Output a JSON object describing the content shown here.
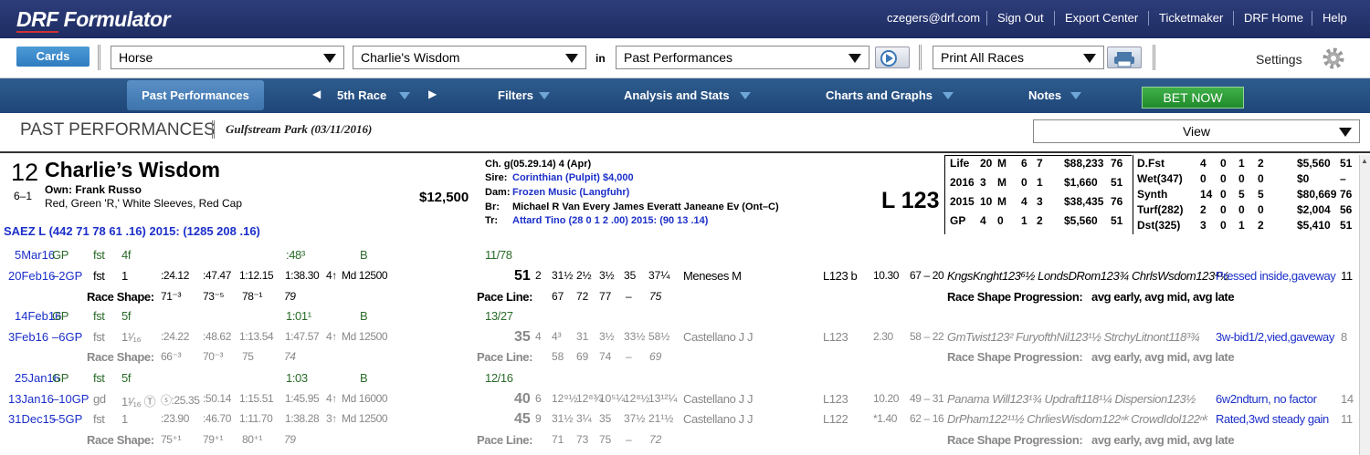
{
  "app": {
    "logo_a": "DRF",
    "logo_b": "Formulator"
  },
  "toplinks": [
    "czegers@drf.com",
    "Sign Out",
    "Export Center",
    "Ticketmaker",
    "DRF Home",
    "Help"
  ],
  "toolbar": {
    "cards": "Cards",
    "s1": "Horse",
    "s2": "Charlie's Wisdom",
    "in": "in",
    "s3": "Past Performances",
    "s4": "Print All Races",
    "settings": "Settings"
  },
  "nav": {
    "pp": "Past Performances",
    "race": "5th Race",
    "filters": "Filters",
    "analysis": "Analysis and Stats",
    "charts": "Charts and Graphs",
    "notes": "Notes",
    "bet": "BET NOW"
  },
  "section": {
    "title": "PAST PERFORMANCES",
    "track": "Gulfstream Park (03/11/2016)",
    "view": "View"
  },
  "horse": {
    "num": "12",
    "odds": "6–1",
    "name": "Charlie’s Wisdom",
    "owner": "Own: Frank Russo",
    "silks": "Red, Green 'R,' White Sleeves, Red Cap",
    "price": "$12,500",
    "jockey": "SAEZ L (442 71 78 61 .16) 2015: (1285 208 .16)",
    "weight": "L 123",
    "ped": {
      "l1": "Ch. g(05.29.14) 4 (Apr)",
      "sire_l": "Sire:",
      "sire": "Corinthian (Pulpit) $4,000",
      "dam_l": "Dam:",
      "dam": "Frozen Music (Langfuhr)",
      "br_l": "Br:",
      "br": "Michael R Van Every James Everatt Janeane Ev (Ont–C)",
      "tr_l": "Tr:",
      "tr": "Attard Tino (28 0 1 2 .00) 2015: (90 13 .14)"
    }
  },
  "stats1": [
    [
      "Life",
      "20",
      "M",
      "6",
      "7",
      "$88,233",
      "76"
    ],
    [
      "2016",
      "3",
      "M",
      "0",
      "1",
      "$1,660",
      "51"
    ],
    [
      "2015",
      "10",
      "M",
      "4",
      "3",
      "$38,435",
      "76"
    ],
    [
      "GP",
      "4",
      "0",
      "1",
      "2",
      "$5,560",
      "51"
    ]
  ],
  "stats2": [
    [
      "D.Fst",
      "4",
      "0",
      "1",
      "2",
      "$5,560",
      "51"
    ],
    [
      "Wet(347)",
      "0",
      "0",
      "0",
      "0",
      "$0",
      "–"
    ],
    [
      "Synth",
      "14",
      "0",
      "5",
      "5",
      "$80,669",
      "76"
    ],
    [
      "Turf(282)",
      "2",
      "0",
      "0",
      "0",
      "$2,004",
      "56"
    ],
    [
      "Dst(325)",
      "3",
      "0",
      "1",
      "2",
      "$5,410",
      "51"
    ]
  ],
  "w1": {
    "date": "5Mar16",
    "trk": "GP",
    "cond": "fst",
    "dist": "4f",
    "time": ":48³",
    "grade": "B",
    "rank": "11/78"
  },
  "r1": {
    "date": "20Feb16",
    "trk": "–2GP",
    "cond": "fst",
    "dist": "1",
    "f1": ":24.12",
    "f2": ":47.47",
    "f3": "1:12.15",
    "f4": "1:38.30",
    "age": "4↑",
    "cls": "Md 12500",
    "sp": "51",
    "pp": "2",
    "c1": "31½",
    "c2": "2½",
    "c3": "3½",
    "c4": "35",
    "c5": "37¼",
    "jock": "Meneses M",
    "wt": "L123 b",
    "odds": "10.30",
    "pos": "67 – 20",
    "comp": "KngsKnght123⁶½ LondsDRom123¾ ChrlsWsdom123⁴½",
    "comment": "Pressed inside,gaveway",
    "fld": "11"
  },
  "rs1": {
    "label": "Race Shape:",
    "a": "71⁻³",
    "b": "73⁻⁵",
    "c": "78⁻¹",
    "d": "79",
    "pl": "Pace Line:",
    "p1": "67",
    "p2": "72",
    "p3": "77",
    "p4": "–",
    "p5": "75",
    "rsp": "Race Shape Progression:",
    "rspv": "avg early, avg mid, avg late"
  },
  "w2": {
    "date": "14Feb16",
    "trk": "GP",
    "cond": "fst",
    "dist": "5f",
    "time": "1:01¹",
    "grade": "B",
    "rank": "13/27"
  },
  "r2": {
    "date": "3Feb16",
    "trk": "–6GP",
    "cond": "fst",
    "dist": "1¹⁄₁₆",
    "f1": ":24.22",
    "f2": ":48.62",
    "f3": "1:13.54",
    "f4": "1:47.57",
    "age": "4↑",
    "cls": "Md 12500",
    "sp": "35",
    "pp": "4",
    "c1": "4³",
    "c2": "31",
    "c3": "3½",
    "c4": "33½",
    "c5": "58½",
    "jock": "Castellano J J",
    "wt": "L123",
    "odds": "2.30",
    "pos": "58 – 22",
    "comp": "GmTwist123² FuryofthNil123¹½ StrchyLitnont118³¾",
    "comment": "3w-bid1/2,vied,gaveway",
    "fld": "8"
  },
  "rs2": {
    "label": "Race Shape:",
    "a": "66⁻³",
    "b": "70⁻³",
    "c": "75",
    "d": "74",
    "pl": "Pace Line:",
    "p1": "58",
    "p2": "69",
    "p3": "74",
    "p4": "–",
    "p5": "69",
    "rsp": "Race Shape Progression:",
    "rspv": "avg early, avg mid, avg late"
  },
  "w3": {
    "date": "25Jan16",
    "trk": "GP",
    "cond": "fst",
    "dist": "5f",
    "time": "1:03",
    "grade": "B",
    "rank": "12/16"
  },
  "r3": {
    "date": "13Jan16",
    "trk": "–10GP",
    "cond": "gd",
    "dist": "1¹⁄₁₆ Ⓣ",
    "f1": "ⓢ:25.35",
    "f2": ":50.14",
    "f3": "1:15.51",
    "f4": "1:45.95",
    "age": "4↑",
    "cls": "Md 16000",
    "sp": "40",
    "pp": "6",
    "c1": "12⁹½",
    "c2": "12⁸¾",
    "c3": "10⁵¼",
    "c4": "12⁸½",
    "c5": "13¹²¼",
    "jock": "Castellano J J",
    "wt": "L123",
    "odds": "10.20",
    "pos": "49 – 31",
    "comp": "Panama Will123¹¾ Updraft118¹¼ Dispersion123½",
    "comment": "6w2ndturn, no factor",
    "fld": "14"
  },
  "r4": {
    "date": "31Dec15",
    "trk": "–5GP",
    "cond": "fst",
    "dist": "1",
    "f1": ":23.90",
    "f2": ":46.70",
    "f3": "1:11.70",
    "f4": "1:38.28",
    "age": "3↑",
    "cls": "Md 12500",
    "sp": "45",
    "pp": "9",
    "c1": "31½",
    "c2": "3¼",
    "c3": "35",
    "c4": "37½",
    "c5": "21¹½",
    "jock": "Castellano J J",
    "wt": "L122",
    "odds": "*1.40",
    "pos": "62 – 16",
    "comp": "DrPham122¹¹½ ChrliesWisdom122ⁿᵏ CrowdIdol122ⁿᵏ",
    "comment": "Rated,3wd steady gain",
    "fld": "11"
  },
  "rs4": {
    "label": "Race Shape:",
    "a": "75⁺¹",
    "b": "79⁺¹",
    "c": "80⁺¹",
    "d": "79",
    "pl": "Pace Line:",
    "p1": "71",
    "p2": "73",
    "p3": "75",
    "p4": "–",
    "p5": "72",
    "rsp": "Race Shape Progression:",
    "rspv": "avg early, avg mid, avg late"
  },
  "colors": {
    "topbar": "#1e2c62",
    "navbar": "#1f4678",
    "link": "#1b2fc9",
    "green": "#2a6b2a"
  }
}
